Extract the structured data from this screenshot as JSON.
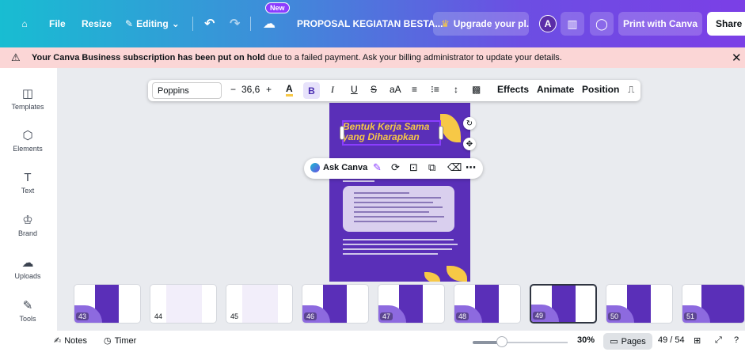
{
  "topbar": {
    "file": "File",
    "resize": "Resize",
    "editing": "Editing",
    "editing_chevron": "⌄",
    "new_badge": "New",
    "doc_title": "PROPOSAL KEGIATAN BESTA...",
    "upgrade": "Upgrade your pl...",
    "avatar_initial": "A",
    "print": "Print with Canva",
    "share": "Share"
  },
  "alert": {
    "bold_text": "Your Canva Business subscription has been put on hold",
    "rest_text": " due to a failed payment. Ask your billing administrator to update your details."
  },
  "sidebar": {
    "items": [
      {
        "label": "Templates",
        "icon": "◫"
      },
      {
        "label": "Elements",
        "icon": "⬡"
      },
      {
        "label": "Text",
        "icon": "T"
      },
      {
        "label": "Brand",
        "icon": "♔"
      },
      {
        "label": "Uploads",
        "icon": "☁"
      },
      {
        "label": "Tools",
        "icon": "✎"
      },
      {
        "label": "",
        "icon": "▭"
      }
    ]
  },
  "format_toolbar": {
    "font": "Poppins",
    "minus": "−",
    "size": "36,6",
    "plus": "+",
    "color": "A",
    "bold": "B",
    "italic": "I",
    "underline": "U",
    "strike": "S",
    "case": "aA",
    "align": "≡",
    "list": "⁝≡",
    "spacing": "↕",
    "effects": "Effects",
    "animate": "Animate",
    "position": "Position"
  },
  "page": {
    "title_line1": "Bentuk Kerja Sama",
    "title_line2": "yang Diharapkan"
  },
  "context_menu": {
    "ask_canva": "Ask Canva"
  },
  "thumbnails": {
    "pages": [
      "43",
      "44",
      "45",
      "46",
      "47",
      "48",
      "49",
      "50",
      "51"
    ],
    "selected": "49"
  },
  "bottombar": {
    "notes": "Notes",
    "timer": "Timer",
    "zoom": "30%",
    "pages": "Pages",
    "page_count": "49 / 54"
  },
  "colors": {
    "brand_purple": "#8b3dff",
    "page_purple": "#5a2fb8",
    "accent_yellow": "#f7c846",
    "alert_bg": "#fbd6d6"
  }
}
